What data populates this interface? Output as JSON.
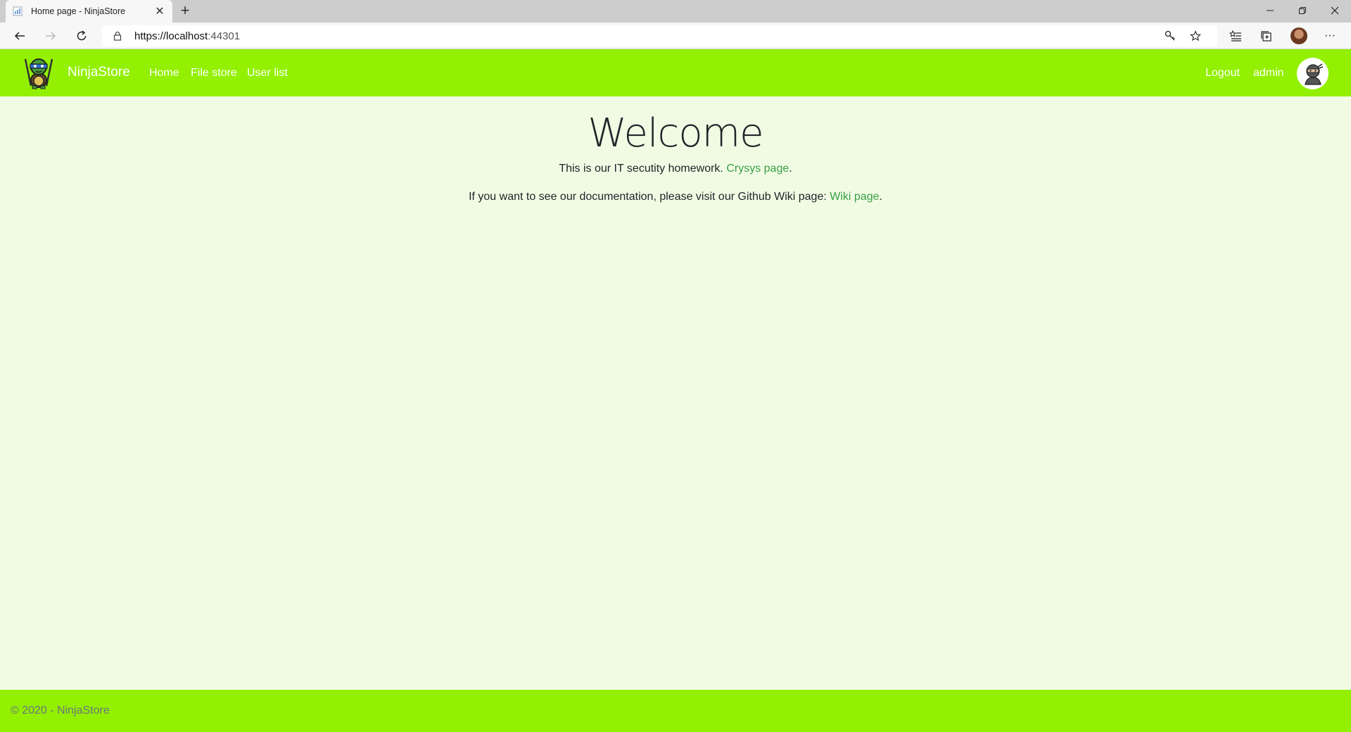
{
  "browser": {
    "tab_title": "Home page - NinjaStore",
    "tab_close": "✕",
    "new_tab": "+",
    "url_host": "https://localhost",
    "url_port": ":44301",
    "more": "···"
  },
  "site": {
    "brand": "NinjaStore",
    "nav": [
      {
        "label": "Home"
      },
      {
        "label": "File store"
      },
      {
        "label": "User list"
      }
    ],
    "logout": "Logout",
    "username": "admin"
  },
  "main": {
    "heading": "Welcome",
    "line1_text": "This is our IT secutity homework. ",
    "line1_link": "Crysys page",
    "line1_end": ".",
    "line2_text": "If you want to see our documentation, please visit our Github Wiki page: ",
    "line2_link": "Wiki page",
    "line2_end": "."
  },
  "footer": {
    "text": "© 2020 - NinjaStore"
  },
  "colors": {
    "header_bg": "#92f000",
    "main_bg": "#f1fbe4",
    "link": "#38a045"
  }
}
